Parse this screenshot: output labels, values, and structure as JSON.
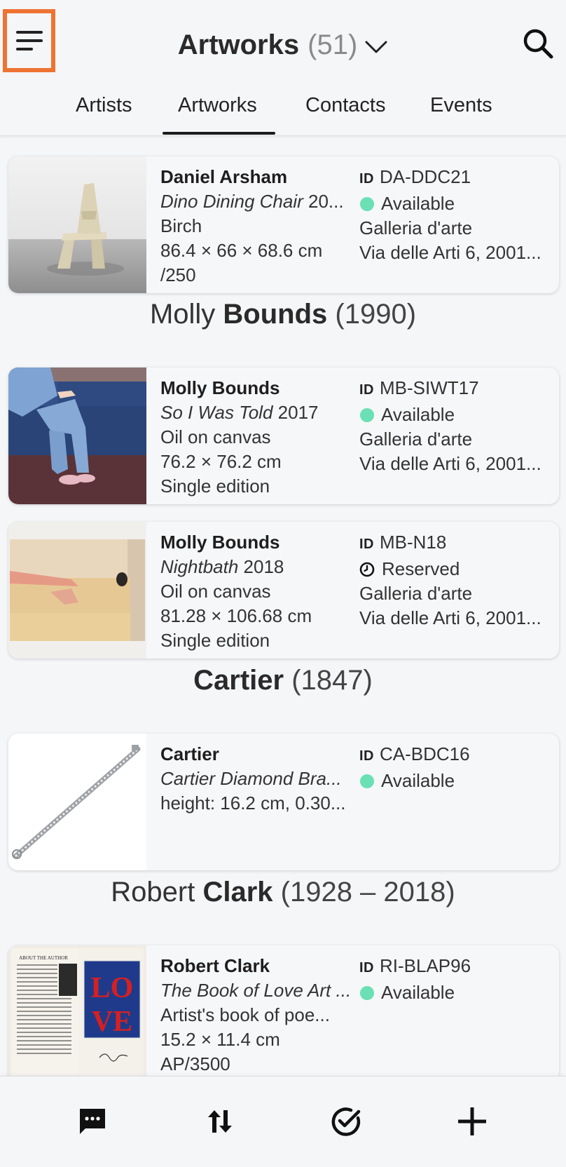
{
  "header": {
    "title": "Artworks",
    "count": "(51)",
    "tabs": [
      {
        "label": "Artists",
        "active": false
      },
      {
        "label": "Artworks",
        "active": true
      },
      {
        "label": "Contacts",
        "active": false
      },
      {
        "label": "Events",
        "active": false
      }
    ]
  },
  "sections": [
    {
      "first": "Molly",
      "last": "Bounds",
      "years": "(1990)"
    },
    {
      "first": "",
      "last": "Cartier",
      "years": "(1847)"
    },
    {
      "first": "Robert",
      "last": "Clark",
      "years": "(1928 – 2018)"
    }
  ],
  "cards": [
    {
      "artist": "Daniel Arsham",
      "title": "Dino Dining Chair",
      "year": "20...",
      "medium": "Birch",
      "dimensions": "86.4 × 66 × 68.6 cm",
      "edition": "/250",
      "id_tag": "ID",
      "id": "DA-DDC21",
      "status": "Available",
      "location": "Galleria d'arte",
      "address": "Via delle Arti 6, 2001..."
    },
    {
      "artist": "Molly Bounds",
      "title": "So I Was Told",
      "year": "2017",
      "medium": "Oil on canvas",
      "dimensions": "76.2 × 76.2 cm",
      "edition": "Single edition",
      "id_tag": "ID",
      "id": "MB-SIWT17",
      "status": "Available",
      "location": "Galleria d'arte",
      "address": "Via delle Arti 6, 2001..."
    },
    {
      "artist": "Molly Bounds",
      "title": "Nightbath",
      "year": "2018",
      "medium": "Oil on canvas",
      "dimensions": "81.28 × 106.68 cm",
      "edition": "Single edition",
      "id_tag": "ID",
      "id": "MB-N18",
      "status": "Reserved",
      "location": "Galleria d'arte",
      "address": "Via delle Arti 6, 2001..."
    },
    {
      "artist": "Cartier",
      "title": "Cartier Diamond Bra...",
      "year": "",
      "medium": "height: 16.2 cm, 0.30...",
      "dimensions": "",
      "edition": "",
      "id_tag": "ID",
      "id": "CA-BDC16",
      "status": "Available",
      "location": "",
      "address": ""
    },
    {
      "artist": "Robert Clark",
      "title": "The Book of Love Art ...",
      "year": "",
      "medium": "Artist's book of poe...",
      "dimensions": "15.2 × 11.4 cm",
      "edition": "AP/3500",
      "id_tag": "ID",
      "id": "RI-BLAP96",
      "status": "Available",
      "location": "",
      "address": ""
    }
  ],
  "thumb_text": {
    "book_header": "ABOUT THE AUTHOR",
    "love_top": "LO",
    "love_bottom": "VE"
  },
  "bottom_bar": [
    "chat-icon",
    "sort-icon",
    "check-circle-icon",
    "add-icon"
  ],
  "colors": {
    "accent_orange": "#ee7333",
    "available_green": "#6be0b5",
    "background": "#f5f6f8"
  }
}
